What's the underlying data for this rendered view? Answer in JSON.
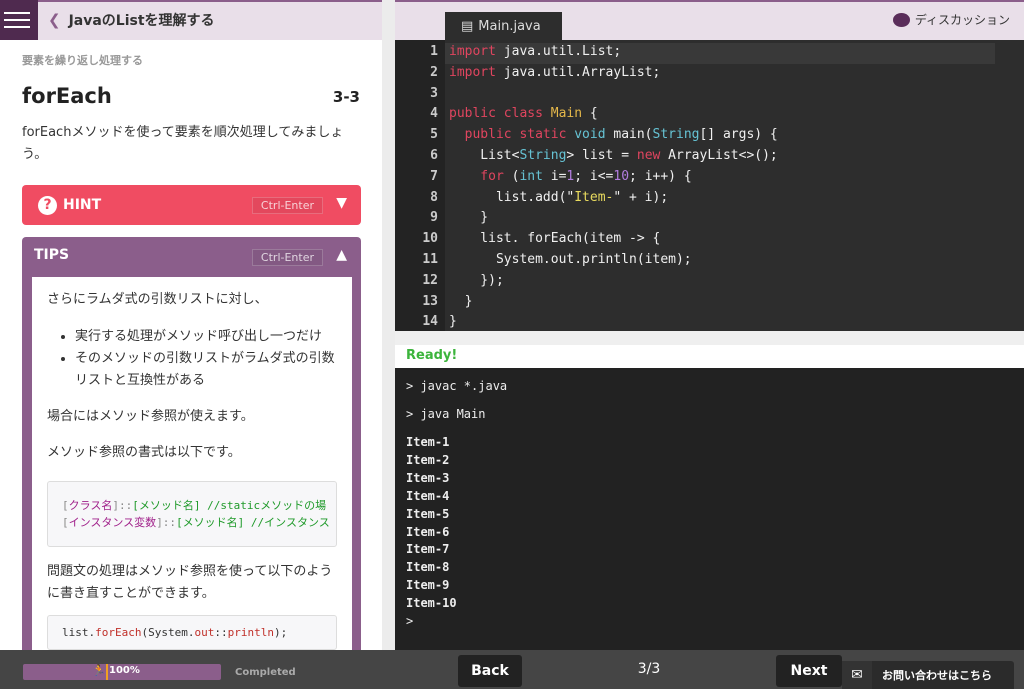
{
  "header": {
    "course_title": "JavaのListを理解する",
    "back_icon": "chevron-left-icon",
    "menu_icon": "hamburger-menu-icon"
  },
  "lesson": {
    "section": "要素を繰り返し処理する",
    "title": "forEach",
    "number": "3-3",
    "description": "forEachメソッドを使って要素を順次処理してみましょう。"
  },
  "hint": {
    "label": "HINT",
    "shortcut": "Ctrl-Enter",
    "color": "#f04c62"
  },
  "tips": {
    "label": "TIPS",
    "shortcut": "Ctrl-Enter",
    "color": "#8b5e8b",
    "p1": "さらにラムダ式の引数リストに対し、",
    "bullets": [
      "実行する処理がメソッド呼び出し一つだけ",
      "そのメソッドの引数リストがラムダ式の引数リストと互換性がある"
    ],
    "p2": "場合にはメソッド参照が使えます。",
    "p3": "メソッド参照の書式は以下です。",
    "syntax": [
      [
        "[",
        "クラス名",
        "]::",
        "[メソッド名] //staticメソッドの場"
      ],
      [
        "[",
        "インスタンス変数",
        "]::",
        "[メソッド名] //インスタンス"
      ]
    ],
    "p4": "問題文の処理はメソッド参照を使って以下のように書き直すことができます。",
    "example": [
      "list.",
      "forEach",
      "(System.",
      "out",
      "::",
      "println",
      ");"
    ]
  },
  "editor": {
    "tab": "Main.java",
    "file_icon": "file-icon",
    "discussion": "ディスカッション",
    "discussion_icon": "chat-bubble-icon",
    "lines": [
      [
        [
          "import",
          "kw"
        ],
        [
          " java.util.List;",
          "pl"
        ]
      ],
      [
        [
          "import",
          "kw"
        ],
        [
          " java.util.ArrayList;",
          "pl"
        ]
      ],
      [],
      [
        [
          "public class ",
          "kw"
        ],
        [
          "Main",
          "cls"
        ],
        [
          " {",
          "pl"
        ]
      ],
      [
        [
          "  public static ",
          "kw"
        ],
        [
          "void",
          "ty"
        ],
        [
          " main(",
          "pl"
        ],
        [
          "String",
          "ty"
        ],
        [
          "[] args) {",
          "pl"
        ]
      ],
      [
        [
          "    List<",
          "pl"
        ],
        [
          "String",
          "ty"
        ],
        [
          "> list = ",
          "pl"
        ],
        [
          "new",
          "kw"
        ],
        [
          " ArrayList<>();",
          "pl"
        ]
      ],
      [
        [
          "    for",
          "kw"
        ],
        [
          " (",
          "pl"
        ],
        [
          "int",
          "ty"
        ],
        [
          " i=",
          "pl"
        ],
        [
          "1",
          "nm"
        ],
        [
          "; i<=",
          "pl"
        ],
        [
          "10",
          "nm"
        ],
        [
          "; i++) {",
          "pl"
        ]
      ],
      [
        [
          "      list.add(\"",
          "pl"
        ],
        [
          "Item-",
          "str"
        ],
        [
          "\" + i);",
          "pl"
        ]
      ],
      [
        [
          "    }",
          "pl"
        ]
      ],
      [
        [
          "    list. forEach(item -> {",
          "pl"
        ]
      ],
      [
        [
          "      System.out.println(item);",
          "pl"
        ]
      ],
      [
        [
          "    });",
          "pl"
        ]
      ],
      [
        [
          "  }",
          "pl"
        ]
      ],
      [
        [
          "}",
          "pl"
        ]
      ]
    ]
  },
  "console": {
    "status": "Ready!",
    "commands": [
      "> javac *.java",
      "> java Main"
    ],
    "output": [
      "Item-1",
      "Item-2",
      "Item-3",
      "Item-4",
      "Item-5",
      "Item-6",
      "Item-7",
      "Item-8",
      "Item-9",
      "Item-10"
    ],
    "prompt": ">"
  },
  "footer": {
    "progress_percent": 100,
    "progress_label": "100%",
    "completed": "Completed",
    "back": "Back",
    "next": "Next",
    "page": "3/3",
    "contact": "お問い合わせはこちら",
    "contact_icon": "mail-icon"
  }
}
